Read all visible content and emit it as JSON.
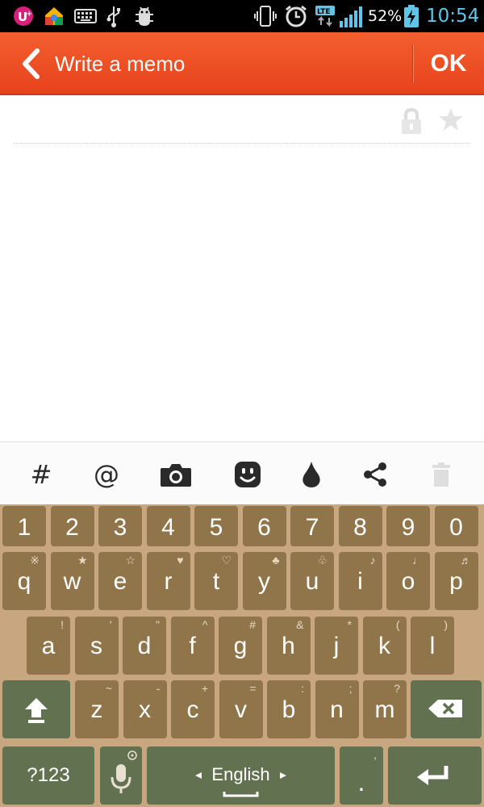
{
  "status_bar": {
    "battery_percent": "52%",
    "time": "10:54",
    "network_label": "LTE"
  },
  "action_bar": {
    "title": "Write a memo",
    "ok_label": "OK",
    "color": "#ee4f24"
  },
  "editor_toolbar": {
    "hash": "#",
    "at": "@"
  },
  "keyboard": {
    "number_row": [
      "1",
      "2",
      "3",
      "4",
      "5",
      "6",
      "7",
      "8",
      "9",
      "0"
    ],
    "row1": [
      "q",
      "w",
      "e",
      "r",
      "t",
      "y",
      "u",
      "i",
      "o",
      "p"
    ],
    "row1_hints": [
      "※",
      "★",
      "☆",
      "♥",
      "♡",
      "♣",
      "♧",
      "♪",
      "♩",
      "♬"
    ],
    "row2": [
      "a",
      "s",
      "d",
      "f",
      "g",
      "h",
      "j",
      "k",
      "l"
    ],
    "row2_hints": [
      "!",
      "'",
      "\"",
      "^",
      "#",
      "&",
      "*",
      "(",
      ")"
    ],
    "row3": [
      "z",
      "x",
      "c",
      "v",
      "b",
      "n",
      "m"
    ],
    "row3_hints": [
      "~",
      "-",
      "+",
      "=",
      ":",
      ";",
      "?"
    ],
    "symbols_label": "?123",
    "language_label": "English",
    "period_label": ".",
    "period_hint": ","
  }
}
